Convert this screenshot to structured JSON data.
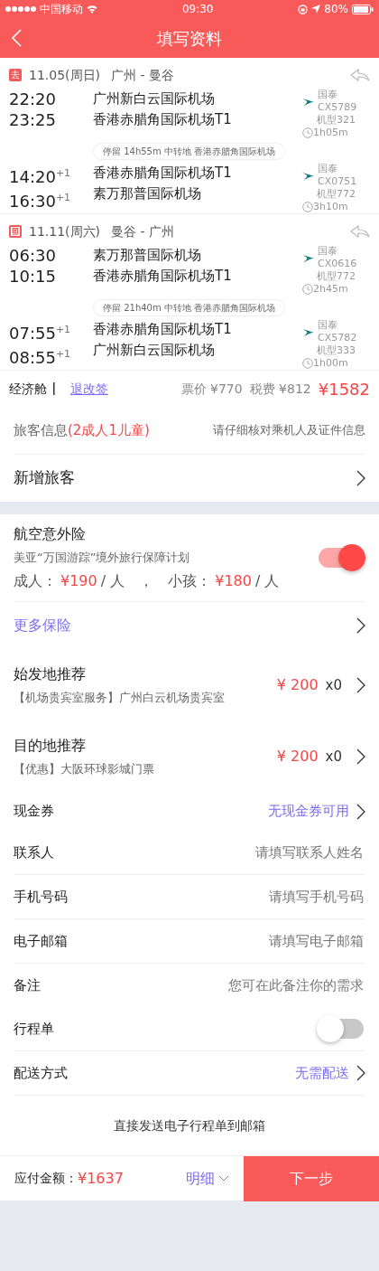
{
  "status_bar": {
    "carrier": "中国移动",
    "time": "09:30",
    "battery": "80%"
  },
  "header": {
    "title": "填写资料"
  },
  "trips": [
    {
      "tag": "去",
      "date": "11.05(周日)",
      "route": "广州 - 曼谷",
      "items": [
        {
          "kind": "segment",
          "dep_time": "22:20",
          "arr_time": "23:25",
          "from": "广州新白云国际机场",
          "to": "香港赤腊角国际机场T1",
          "flight": "国泰CX5789",
          "aircraft": "机型321",
          "duration": "1h05m"
        },
        {
          "kind": "stop",
          "text": "停留 14h55m 中转地 香港赤腊角国际机场"
        },
        {
          "kind": "segment",
          "dep_time": "14:20",
          "dep_day": "+1",
          "arr_time": "16:30",
          "arr_day": "+1",
          "from": "香港赤腊角国际机场T1",
          "to": "素万那普国际机场",
          "flight": "国泰CX0751",
          "aircraft": "机型772",
          "duration": "3h10m"
        }
      ]
    },
    {
      "tag": "回",
      "date": "11.11(周六)",
      "route": "曼谷 - 广州",
      "items": [
        {
          "kind": "segment",
          "dep_time": "06:30",
          "arr_time": "10:15",
          "from": "素万那普国际机场",
          "to": "香港赤腊角国际机场T1",
          "flight": "国泰CX0616",
          "aircraft": "机型772",
          "duration": "2h45m"
        },
        {
          "kind": "stop",
          "text": "停留 21h40m 中转地 香港赤腊角国际机场"
        },
        {
          "kind": "segment",
          "dep_time": "07:55",
          "dep_day": "+1",
          "arr_time": "08:55",
          "arr_day": "+1",
          "from": "香港赤腊角国际机场T1",
          "to": "广州新白云国际机场",
          "flight": "国泰CX5782",
          "aircraft": "机型333",
          "duration": "1h00m"
        }
      ]
    }
  ],
  "fare": {
    "cabin": "经济舱",
    "change_link": "退改签",
    "ticket": "票价 ¥770",
    "tax": "税费 ¥812",
    "total": "¥1582"
  },
  "passengers": {
    "title": "旅客信息",
    "count": "(2成人1儿童)",
    "hint": "请仔细核对乘机人及证件信息",
    "add": "新增旅客"
  },
  "insurance": {
    "title": "航空意外险",
    "description": "美亚“万国游踪”境外旅行保障计划",
    "on": true,
    "prices": [
      {
        "label": "成人：",
        "price": "¥190",
        "unit": "/ 人"
      },
      {
        "label": "小孩：",
        "price": "¥180",
        "unit": "/ 人"
      }
    ],
    "separator": "，",
    "more": "更多保险"
  },
  "recommendations": [
    {
      "title": "始发地推荐",
      "description": "【机场贵宾室服务】广州白云机场贵宾室",
      "price": "¥ 200",
      "quantity": "x0"
    },
    {
      "title": "目的地推荐",
      "description": "【优惠】大阪环球影城门票",
      "price": "¥ 200",
      "quantity": "x0"
    }
  ],
  "coupon": {
    "label": "现金券",
    "value": "无现金券可用"
  },
  "contact_fields": [
    {
      "label": "联系人",
      "placeholder": "请填写联系人姓名"
    },
    {
      "label": "手机号码",
      "placeholder": "请填写手机号码"
    },
    {
      "label": "电子邮箱",
      "placeholder": "请填写电子邮箱"
    },
    {
      "label": "备注",
      "placeholder": "您可在此备注你的需求"
    }
  ],
  "itinerary": {
    "label": "行程单",
    "on": false
  },
  "delivery": {
    "label": "配送方式",
    "value": "无需配送",
    "note": "直接发送电子行程单到邮箱"
  },
  "footer": {
    "total_label": "应付金额：",
    "total": "¥1637",
    "detail": "明细",
    "next": "下一步"
  }
}
